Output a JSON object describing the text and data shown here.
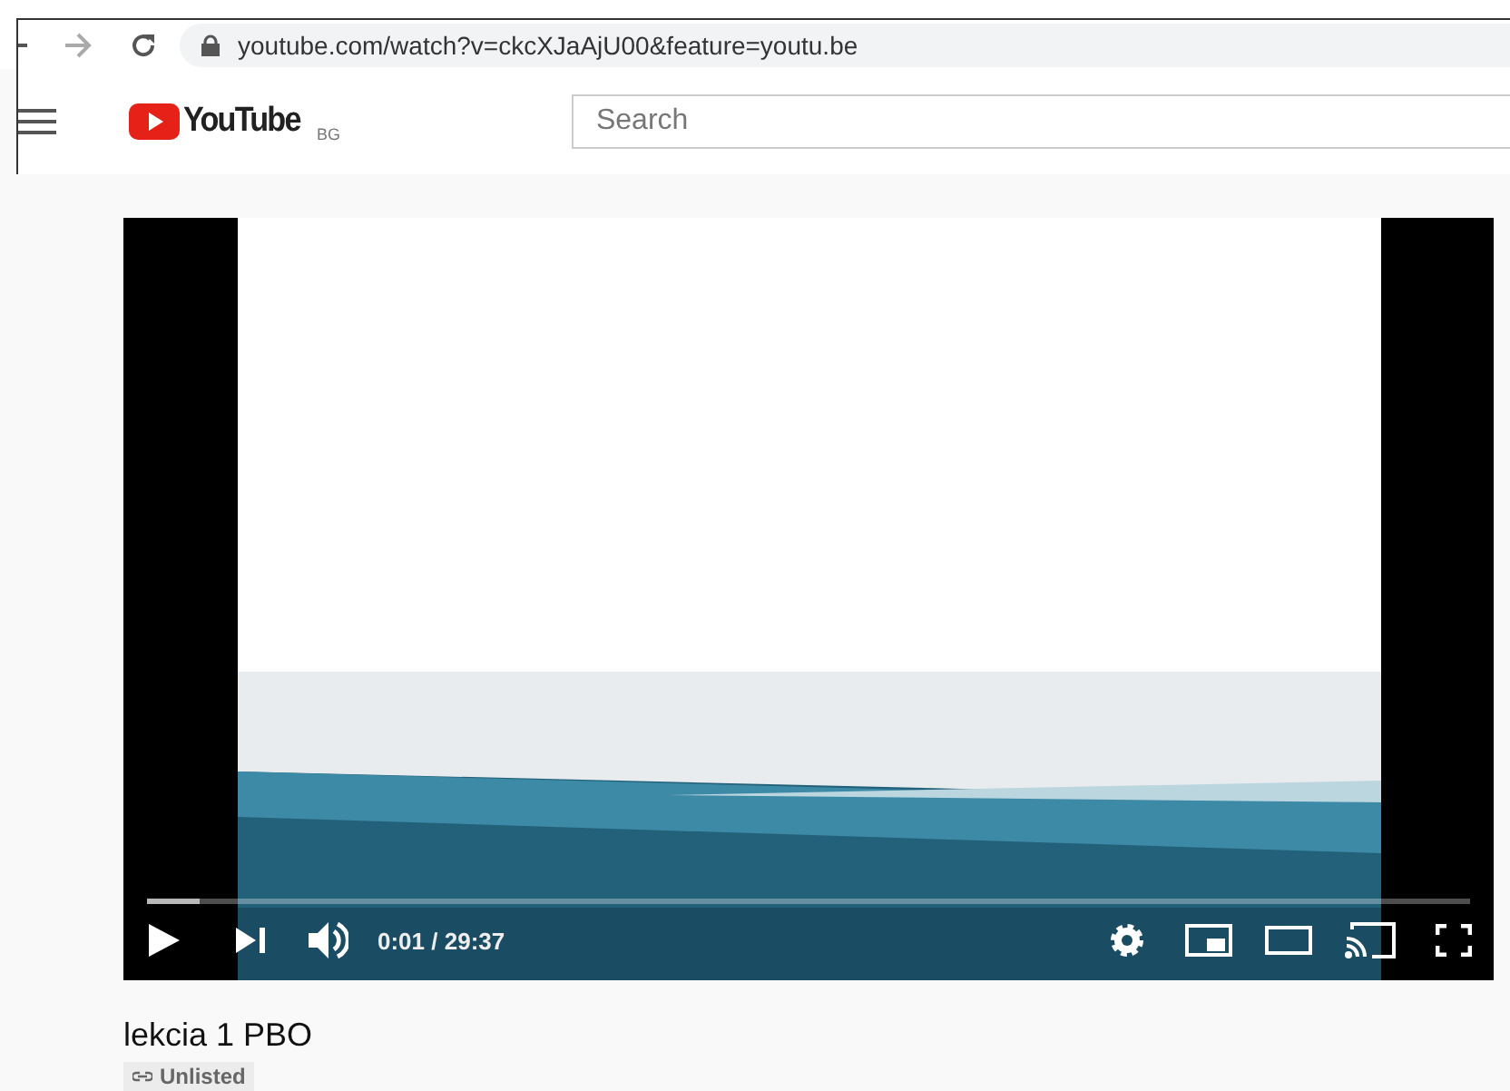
{
  "browser": {
    "url": "youtube.com/watch?v=ckcXJaAjU00&feature=youtu.be"
  },
  "header": {
    "logo_text": "YouTube",
    "region": "BG",
    "search": {
      "placeholder": "Search"
    }
  },
  "player": {
    "progress": {
      "level": 0.04
    },
    "playing": false,
    "time": "0:01 / 29:37"
  },
  "video": {
    "title": "lekcia 1 PBO",
    "privacy": "Unlisted"
  }
}
